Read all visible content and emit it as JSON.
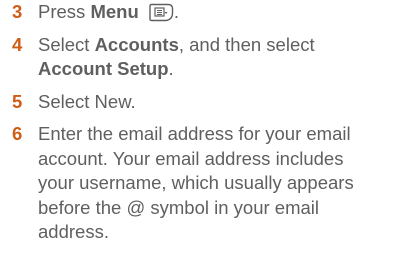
{
  "steps": [
    {
      "number": "3",
      "text_before": "Press ",
      "bold": "Menu",
      "text_after": ".",
      "icon": "menu-key-icon"
    },
    {
      "number": "4",
      "text_before": "Select ",
      "bold1": "Accounts",
      "text_middle": ", and then select",
      "bold2": "Account Setup",
      "text_after": "."
    },
    {
      "number": "5",
      "text": "Select New."
    },
    {
      "number": "6",
      "lines": [
        "Enter the email address for your email",
        "account. Your email address includes",
        "your username, which usually appears",
        "before the @ symbol in your email",
        "address."
      ]
    }
  ],
  "colors": {
    "step_number": "#d05d17",
    "body_text": "#5f5f5f"
  }
}
